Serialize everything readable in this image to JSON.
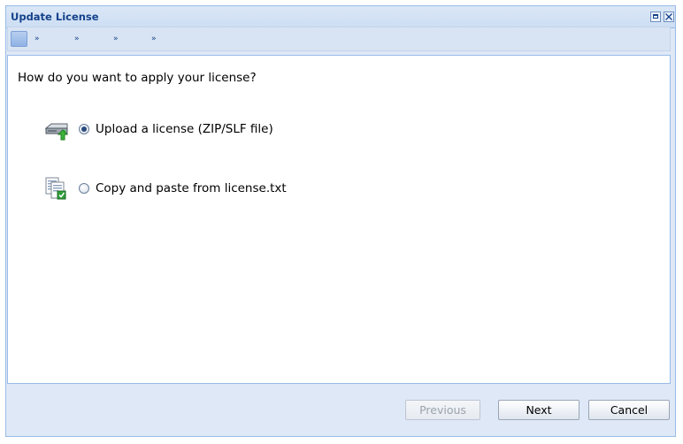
{
  "window": {
    "title": "Update License"
  },
  "steps": {
    "arrows": [
      "»",
      "»",
      "»",
      "»"
    ]
  },
  "main": {
    "question": "How do you want to apply your license?",
    "options": [
      {
        "label": "Upload a license (ZIP/SLF file)",
        "icon": "upload-drive-icon",
        "selected": true
      },
      {
        "label": "Copy and paste from license.txt",
        "icon": "paste-document-icon",
        "selected": false
      }
    ]
  },
  "footer": {
    "previous_label": "Previous",
    "next_label": "Next",
    "cancel_label": "Cancel"
  },
  "colors": {
    "title_text": "#15428b",
    "frame_border": "#99bbe8",
    "frame_background": "#dfe8f6"
  }
}
